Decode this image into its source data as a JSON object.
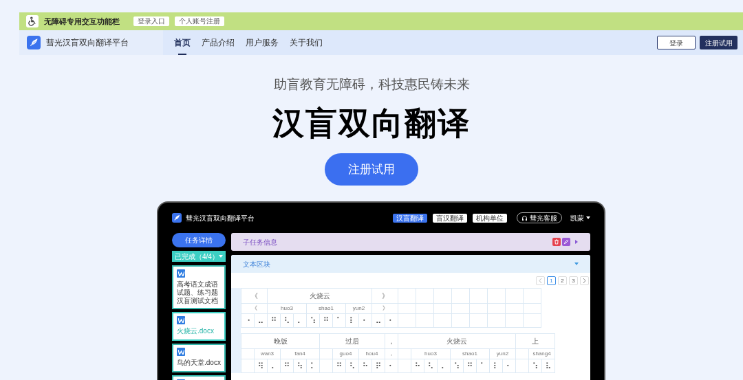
{
  "accessibility_bar": {
    "title": "无障碍专用交互功能栏",
    "buttons": [
      "登录入口",
      "个人账号注册"
    ]
  },
  "nav": {
    "brand": "彗光汉盲双向翻译平台",
    "items": [
      {
        "label": "首页",
        "selected": true
      },
      {
        "label": "产品介绍",
        "selected": false
      },
      {
        "label": "用户服务",
        "selected": false
      },
      {
        "label": "关于我们",
        "selected": false
      }
    ],
    "login": "登录",
    "register": "注册试用"
  },
  "hero": {
    "subtitle": "助盲教育无障碍，科技惠民铸未来",
    "title": "汉盲双向翻译",
    "cta": "注册试用"
  },
  "app": {
    "brand": "彗光汉盲双向翻译平台",
    "tabs": [
      {
        "label": "汉盲翻译",
        "selected": true
      },
      {
        "label": "盲汉翻译",
        "selected": false
      },
      {
        "label": "机构单位",
        "selected": false
      }
    ],
    "support": "彗光客服",
    "user": "凯蒙",
    "task_button": "任务详情",
    "filter": "已完成（4/4）",
    "files": [
      {
        "name": "高考语文成语试题、练习题汉盲测试文档",
        "selected": false
      },
      {
        "name": "火烧云.docx",
        "selected": true
      },
      {
        "name": "鸟的天堂.docx",
        "selected": false
      },
      {
        "selected": false
      }
    ],
    "subtask": {
      "title": "子任务信息",
      "expanded": false
    },
    "text_block": {
      "title": "文本区块",
      "expanded": true
    },
    "pagination": [
      {
        "label": "1",
        "selected": true
      },
      {
        "label": "2",
        "selected": false
      },
      {
        "label": "3",
        "selected": false
      }
    ],
    "blocks": [
      {
        "segments": [
          {
            "word": "《",
            "space_before": false,
            "syllables": [
              {
                "pinyin": "《",
                "braille": [
                  "⠐",
                  "⠤"
                ]
              }
            ]
          },
          {
            "word": "火烧云",
            "space_before": false,
            "syllables": [
              {
                "pinyin": "huo3",
                "braille": [
                  "⠛",
                  "⠣",
                  "⠄"
                ]
              },
              {
                "pinyin": "shao1",
                "braille": [
                  "⠱",
                  "⠛",
                  "⠁"
                ]
              },
              {
                "pinyin": "yun2",
                "braille": [
                  "⠇",
                  "⠂"
                ]
              }
            ]
          },
          {
            "word": "》",
            "space_before": false,
            "syllables": [
              {
                "pinyin": "》",
                "braille": [
                  "⠤",
                  "⠂"
                ]
              }
            ]
          }
        ]
      },
      {
        "segments": [
          {
            "word": "晚饭",
            "space_before": true,
            "syllables": [
              {
                "pinyin": "wan3",
                "braille": [
                  "⠻",
                  "⠄"
                ]
              },
              {
                "pinyin": "fan4",
                "braille": [
                  "⠛",
                  "⠳",
                  "⠅"
                ]
              }
            ]
          },
          {
            "word": "过后",
            "space_before": true,
            "syllables": [
              {
                "pinyin": "guo4",
                "braille": [
                  "⠛",
                  "⠣"
                ]
              },
              {
                "pinyin": "hou4",
                "braille": [
                  "⠓",
                  "⠟"
                ]
              }
            ]
          },
          {
            "word": "，",
            "space_before": false,
            "syllables": [
              {
                "pinyin": "，",
                "braille": [
                  "⠂"
                ]
              }
            ]
          },
          {
            "word": "火烧云",
            "space_before": true,
            "syllables": [
              {
                "pinyin": "huo3",
                "braille": [
                  "⠓",
                  "⠣",
                  "⠄"
                ]
              },
              {
                "pinyin": "shao1",
                "braille": [
                  "⠱",
                  "⠛",
                  "⠁"
                ]
              },
              {
                "pinyin": "yun2",
                "braille": [
                  "⠇",
                  "⠂"
                ]
              }
            ]
          },
          {
            "word": "上",
            "space_before": true,
            "syllables": [
              {
                "pinyin": "shang4",
                "braille": [
                  "⠱",
                  "⠧"
                ]
              }
            ]
          }
        ]
      }
    ]
  }
}
